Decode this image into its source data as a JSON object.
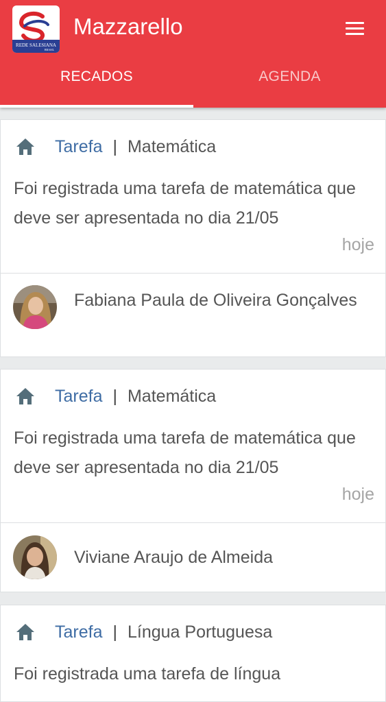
{
  "app": {
    "title": "Mazzarello",
    "logo_text": "REDE SALESIANA BRASIL"
  },
  "tabs": [
    {
      "label": "RECADOS",
      "active": true
    },
    {
      "label": "AGENDA",
      "active": false
    }
  ],
  "colors": {
    "header": "#ea3d43",
    "category": "#3e6ca4",
    "timestamp": "#a5a5a5"
  },
  "messages": [
    {
      "icon": "home-icon",
      "category": "Tarefa",
      "separator": "|",
      "subject": "Matemática",
      "text": "Foi registrada uma tarefa de matemática que deve ser apresentada no dia 21/05",
      "time": "hoje",
      "author": "Fabiana Paula de Oliveira Gonçalves"
    },
    {
      "icon": "home-icon",
      "category": "Tarefa",
      "separator": "|",
      "subject": "Matemática",
      "text": "Foi registrada uma tarefa de matemática que deve ser apresentada no dia 21/05",
      "time": "hoje",
      "author": "Viviane Araujo de Almeida"
    },
    {
      "icon": "home-icon",
      "category": "Tarefa",
      "separator": "|",
      "subject": "Língua Portuguesa",
      "text": "Foi registrada uma tarefa de língua"
    }
  ]
}
